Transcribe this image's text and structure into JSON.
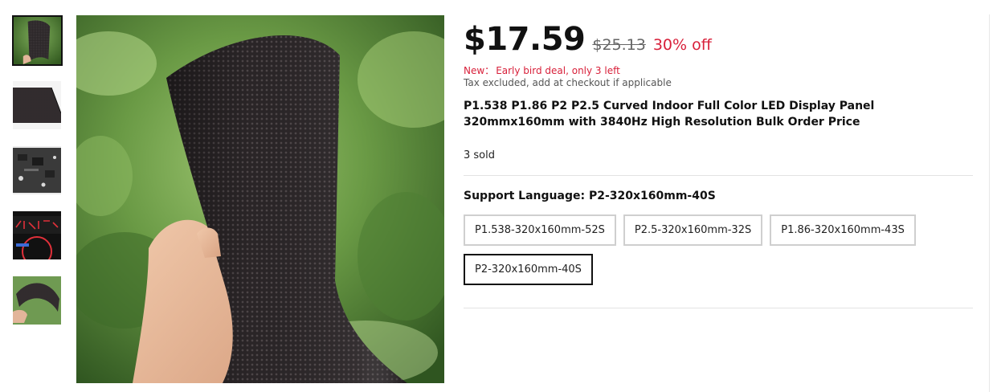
{
  "product": {
    "price": "$17.59",
    "original_price": "$25.13",
    "discount": "30% off",
    "deal_prefix": "New：",
    "deal_text": "Early bird deal, only 3 left",
    "tax_note": "Tax excluded, add at checkout if applicable",
    "title": "P1.538 P1.86 P2 P2.5 Curved Indoor Full Color LED Display Panel 320mmx160mm with 3840Hz High Resolution Bulk Order Price",
    "sold": "3 sold"
  },
  "variant": {
    "label": "Support Language: P2-320x160mm-40S",
    "options": [
      {
        "label": "P1.538-320x160mm-52S",
        "selected": false
      },
      {
        "label": "P2.5-320x160mm-32S",
        "selected": false
      },
      {
        "label": "P1.86-320x160mm-43S",
        "selected": false
      },
      {
        "label": "P2-320x160mm-40S",
        "selected": true
      }
    ]
  },
  "gallery": {
    "active_index": 0,
    "thumbnails": [
      "curved-panel-hand-thumbnail",
      "panel-angle-thumbnail",
      "panel-back-circuit-thumbnail",
      "panel-lit-text-thumbnail",
      "panel-bent-hand-thumbnail"
    ]
  },
  "colors": {
    "accent_red": "#d8203a",
    "selected_border": "#111111",
    "option_border": "#cfcfcf"
  }
}
